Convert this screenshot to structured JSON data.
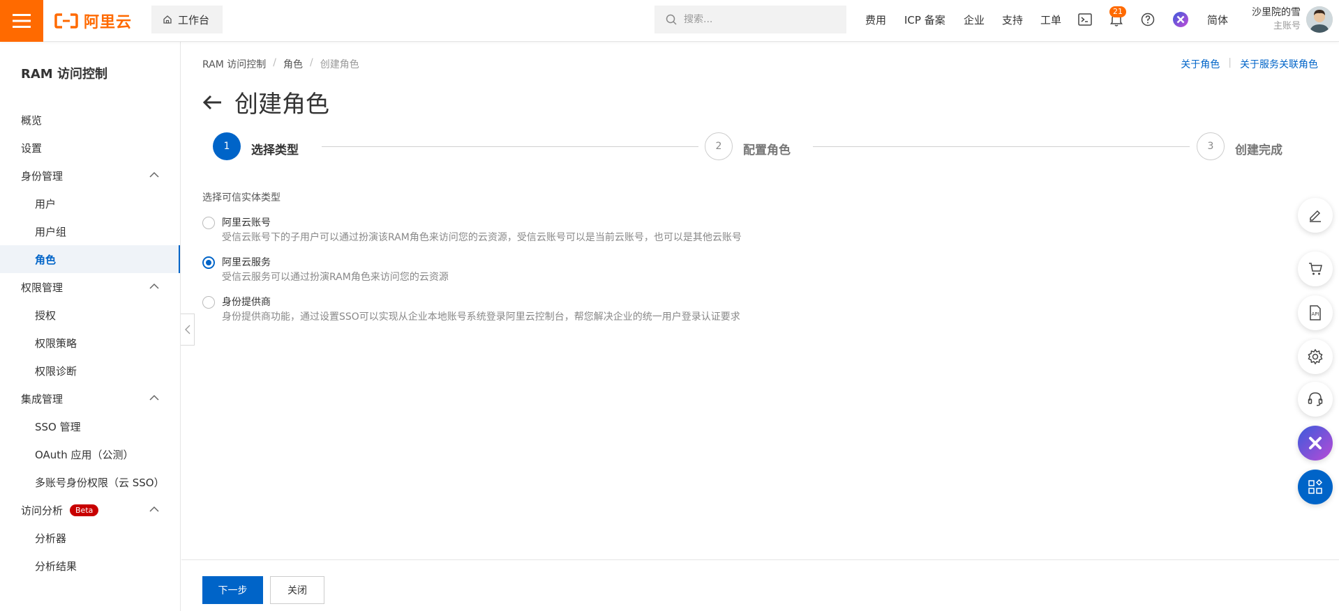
{
  "header": {
    "logo_text": "阿里云",
    "workbench_label": "工作台",
    "search_placeholder": "搜索...",
    "nav": [
      "费用",
      "ICP 备案",
      "企业",
      "支持",
      "工单"
    ],
    "notification_count": "21",
    "language_label": "简体",
    "user_name": "沙里院的雪",
    "user_role": "主账号"
  },
  "sidebar": {
    "title": "RAM 访问控制",
    "items": [
      {
        "label": "概览",
        "level": 1
      },
      {
        "label": "设置",
        "level": 1
      },
      {
        "label": "身份管理",
        "level": 1,
        "group": true
      },
      {
        "label": "用户",
        "level": 2
      },
      {
        "label": "用户组",
        "level": 2
      },
      {
        "label": "角色",
        "level": 2,
        "active": true
      },
      {
        "label": "权限管理",
        "level": 1,
        "group": true
      },
      {
        "label": "授权",
        "level": 2
      },
      {
        "label": "权限策略",
        "level": 2
      },
      {
        "label": "权限诊断",
        "level": 2
      },
      {
        "label": "集成管理",
        "level": 1,
        "group": true
      },
      {
        "label": "SSO 管理",
        "level": 2
      },
      {
        "label": "OAuth 应用（公测）",
        "level": 2
      },
      {
        "label": "多账号身份权限（云 SSO）",
        "level": 2
      },
      {
        "label": "访问分析",
        "level": 1,
        "group": true,
        "badge": "Beta"
      },
      {
        "label": "分析器",
        "level": 2
      },
      {
        "label": "分析结果",
        "level": 2
      }
    ]
  },
  "breadcrumb": [
    "RAM 访问控制",
    "角色",
    "创建角色"
  ],
  "help_links": [
    "关于角色",
    "关于服务关联角色"
  ],
  "page_title": "创建角色",
  "steps": [
    {
      "number": "1",
      "label": "选择类型",
      "status": "active"
    },
    {
      "number": "2",
      "label": "配置角色",
      "status": "pending"
    },
    {
      "number": "3",
      "label": "创建完成",
      "status": "pending"
    }
  ],
  "section_label": "选择可信实体类型",
  "options": [
    {
      "title": "阿里云账号",
      "desc": "受信云账号下的子用户可以通过扮演该RAM角色来访问您的云资源，受信云账号可以是当前云账号，也可以是其他云账号",
      "checked": false
    },
    {
      "title": "阿里云服务",
      "desc": "受信云服务可以通过扮演RAM角色来访问您的云资源",
      "checked": true
    },
    {
      "title": "身份提供商",
      "desc": "身份提供商功能，通过设置SSO可以实现从企业本地账号系统登录阿里云控制台，帮您解决企业的统一用户登录认证要求",
      "checked": false
    }
  ],
  "footer": {
    "next_label": "下一步",
    "close_label": "关闭"
  },
  "colors": {
    "brand_orange": "#ff6a00",
    "primary_blue": "#0064c8",
    "beta_red": "#c80000"
  }
}
